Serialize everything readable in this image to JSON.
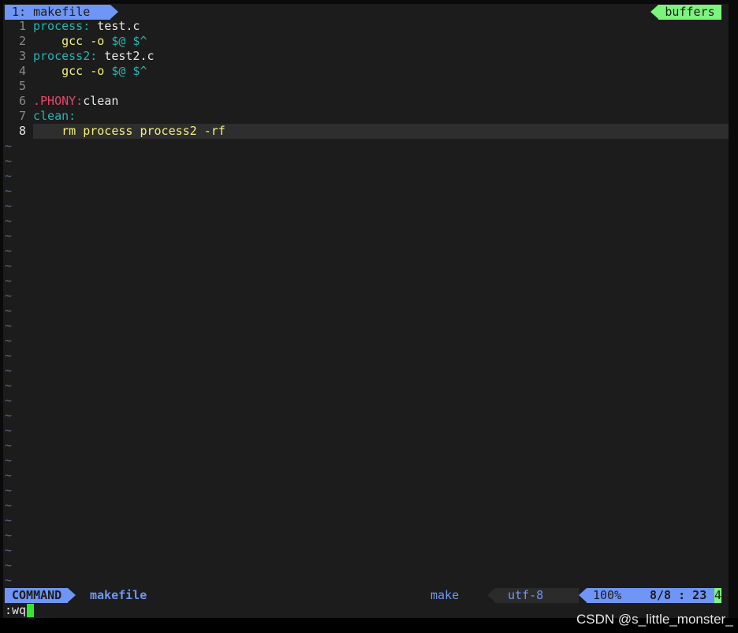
{
  "tabline": {
    "active_tab": "1: makefile",
    "buffers_label": "buffers"
  },
  "lines": [
    {
      "num": "1",
      "parts": [
        {
          "t": "process:",
          "c": "c-target"
        },
        {
          "t": " test.c",
          "c": "c-text"
        }
      ]
    },
    {
      "num": "2",
      "parts": [
        {
          "t": "    gcc -o ",
          "c": "c-yellow"
        },
        {
          "t": "$@ $^",
          "c": "c-var"
        }
      ]
    },
    {
      "num": "3",
      "parts": [
        {
          "t": "process2:",
          "c": "c-target"
        },
        {
          "t": " test2.c",
          "c": "c-text"
        }
      ]
    },
    {
      "num": "4",
      "parts": [
        {
          "t": "    gcc -o ",
          "c": "c-yellow"
        },
        {
          "t": "$@ $^",
          "c": "c-var"
        }
      ]
    },
    {
      "num": "5",
      "parts": []
    },
    {
      "num": "6",
      "parts": [
        {
          "t": ".PHONY:",
          "c": "c-phony"
        },
        {
          "t": "clean",
          "c": "c-text"
        }
      ]
    },
    {
      "num": "7",
      "parts": [
        {
          "t": "clean:",
          "c": "c-target"
        }
      ]
    },
    {
      "num": "8",
      "parts": [
        {
          "t": "    rm process process2 -rf",
          "c": "c-yellow"
        }
      ],
      "current": true
    }
  ],
  "tilde_char": "~",
  "tilde_count": 30,
  "statusline": {
    "mode": "COMMAND",
    "filename": "makefile",
    "filetype": "make",
    "encoding": "utf-8",
    "percent": "100%",
    "position": "8/8 : 23",
    "column_marker": "4"
  },
  "cmdline": {
    "text": ":wq"
  },
  "watermark": "CSDN @s_little_monster_"
}
